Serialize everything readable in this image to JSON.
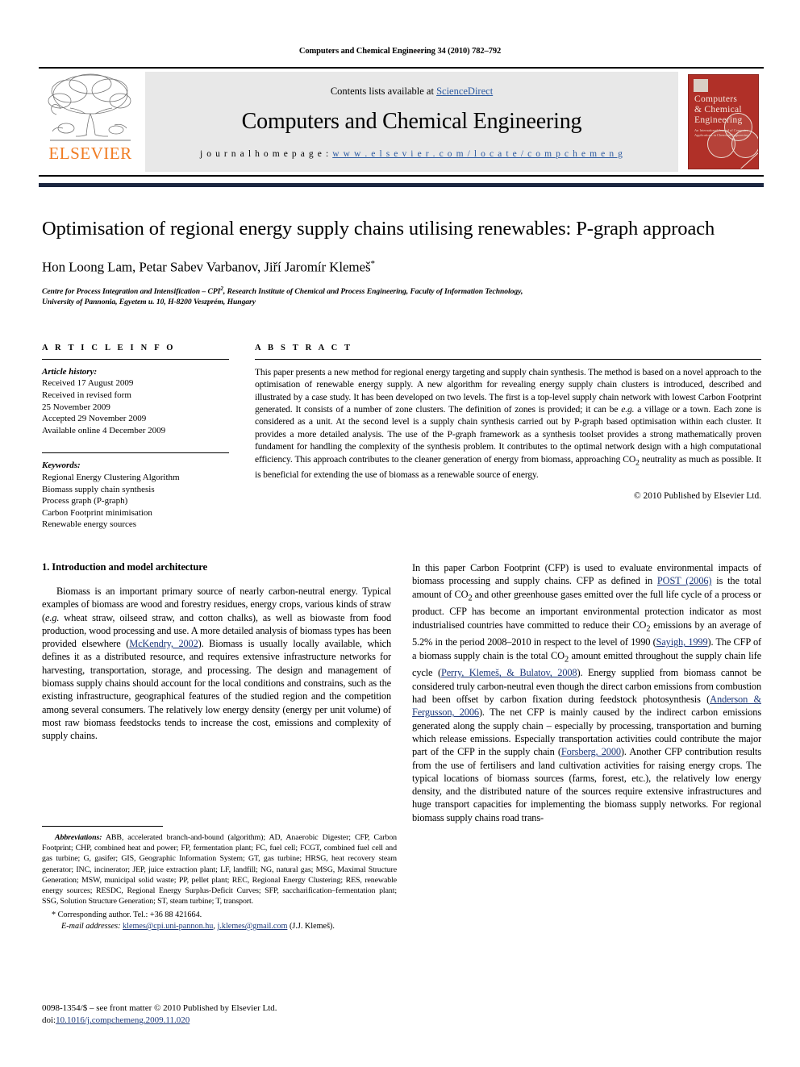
{
  "running_head": "Computers and Chemical Engineering 34 (2010) 782–792",
  "masthead": {
    "publisher_name": "ELSEVIER",
    "contents_prefix": "Contents lists available at ",
    "contents_link": "ScienceDirect",
    "journal_title": "Computers and Chemical Engineering",
    "homepage_label": "j o u r n a l   h o m e p a g e :  ",
    "homepage_url": "w w w . e l s e v i e r . c o m / l o c a t e / c o m p c h e m e n g",
    "cover": {
      "line1": "Computers",
      "line2": "& Chemical",
      "line3": "Engineering",
      "subtitle": "An International Journal of Computer Applications in Chemical Engineering"
    }
  },
  "article": {
    "title": "Optimisation of regional energy supply chains utilising renewables: P-graph approach",
    "authors": "Hon Loong Lam, Petar Sabev Varbanov, Jiří Jaromír Klemeš",
    "corresponding_marker": "*",
    "affiliation_line1": "Centre for Process Integration and Intensification – CPI2, Research Institute of Chemical and Process Engineering, Faculty of Information Technology,",
    "affiliation_line2": "University of Pannonia, Egyetem u. 10, H-8200 Veszprém, Hungary"
  },
  "article_info": {
    "heading": "A R T I C L E   I N F O",
    "history_label": "Article history:",
    "history": [
      "Received 17 August 2009",
      "Received in revised form",
      "25 November 2009",
      "Accepted 29 November 2009",
      "Available online 4 December 2009"
    ],
    "keywords_label": "Keywords:",
    "keywords": [
      "Regional Energy Clustering Algorithm",
      "Biomass supply chain synthesis",
      "Process graph (P-graph)",
      "Carbon Footprint minimisation",
      "Renewable energy sources"
    ]
  },
  "abstract": {
    "heading": "A B S T R A C T",
    "text_part1": "This paper presents a new method for regional energy targeting and supply chain synthesis. The method is based on a novel approach to the optimisation of renewable energy supply. A new algorithm for revealing energy supply chain clusters is introduced, described and illustrated by a case study. It has been developed on two levels. The first is a top-level supply chain network with lowest Carbon Footprint generated. It consists of a number of zone clusters. The definition of zones is provided; it can be ",
    "text_eg": "e.g.",
    "text_part2": " a village or a town. Each zone is considered as a unit. At the second level is a supply chain synthesis carried out by P-graph based optimisation within each cluster. It provides a more detailed analysis. The use of the P-graph framework as a synthesis toolset provides a strong mathematically proven fundament for handling the complexity of the synthesis problem. It contributes to the optimal network design with a high computational efficiency. This approach contributes to the cleaner generation of energy from biomass, approaching CO2 neutrality as much as possible. It is beneficial for extending the use of biomass as a renewable source of energy.",
    "copyright": "© 2010 Published by Elsevier Ltd."
  },
  "section1": {
    "number_title": "1. Introduction and model architecture",
    "para1_a": "Biomass is an important primary source of nearly carbon-neutral energy. Typical examples of biomass are wood and forestry residues, energy crops, various kinds of straw (",
    "para1_eg": "e.g.",
    "para1_b": " wheat straw, oilseed straw, and cotton chalks), as well as biowaste from food production, wood processing and use. A more detailed analysis of biomass types has been provided elsewhere (",
    "para1_ref1": "McKendry, 2002",
    "para1_c": "). Biomass is usually locally available, which defines it as a distributed resource, and requires extensive infrastructure networks for harvesting, transportation, storage, and processing. The design and management of biomass supply chains should account for the local conditions and constrains, such as the existing infrastructure, geographical features of the studied region and the competition among several consumers. The relatively low energy density (energy per unit volume) of most raw biomass feedstocks tends to increase the cost, emissions and complexity of supply chains.",
    "para2_a": "In this paper Carbon Footprint (CFP) is used to evaluate environmental impacts of biomass processing and supply chains. CFP as defined in ",
    "para2_ref1": "POST (2006)",
    "para2_b": " is the total amount of CO2 and other greenhouse gases emitted over the full life cycle of a process or product. CFP has become an important environmental protection indicator as most industrialised countries have committed to reduce their CO2 emissions by an average of 5.2% in the period 2008–2010 in respect to the level of 1990 (",
    "para2_ref2": "Sayigh, 1999",
    "para2_c": "). The CFP of a biomass supply chain is the total CO2 amount emitted throughout the supply chain life cycle (",
    "para2_ref3": "Perry, Klemeš, & Bulatov, 2008",
    "para2_d": "). Energy supplied from biomass cannot be considered truly carbon-neutral even though the direct carbon emissions from combustion had been offset by carbon fixation during feedstock photosynthesis (",
    "para2_ref4": "Anderson & Fergusson, 2006",
    "para2_e": "). The net CFP is mainly caused by the indirect carbon emissions generated along the supply chain – especially by processing, transportation and burning which release emissions. Especially transportation activities could contribute the major part of the CFP in the supply chain (",
    "para2_ref5": "Forsberg, 2000",
    "para2_f": "). Another CFP contribution results from the use of fertilisers and land cultivation activities for raising energy crops. The typical locations of biomass sources (farms, forest, etc.), the relatively low energy density, and the distributed nature of the sources require extensive infrastructures and huge transport capacities for implementing the biomass supply networks. For regional biomass supply chains road trans-"
  },
  "footnotes": {
    "abbrev_label": "Abbreviations:",
    "abbrev_text": " ABB, accelerated branch-and-bound (algorithm); AD, Anaerobic Digester; CFP, Carbon Footprint; CHP, combined heat and power; FP, fermentation plant; FC, fuel cell; FCGT, combined fuel cell and gas turbine; G, gasifer; GIS, Geographic Information System; GT, gas turbine; HRSG, heat recovery steam generator; INC, incinerator; JEP, juice extraction plant; LF, landfill; NG, natural gas; MSG, Maximal Structure Generation; MSW, municipal solid waste; PP, pellet plant; REC, Regional Energy Clustering; RES, renewable energy sources; RESDC, Regional Energy Surplus-Deficit Curves; SFP, saccharification–fermentation plant; SSG, Solution Structure Generation; ST, steam turbine; T, transport.",
    "corresponding": "* Corresponding author. Tel.: +36 88 421664.",
    "email_label": "E-mail addresses:",
    "email1": "klemes@cpi.uni-pannon.hu",
    "email_sep": ", ",
    "email2": "j.klemes@gmail.com",
    "email_suffix": " (J.J. Klemeš).",
    "imprint_line1": "0098-1354/$ – see front matter © 2010 Published by Elsevier Ltd.",
    "imprint_doi_label": "doi:",
    "imprint_doi": "10.1016/j.compchemeng.2009.11.020"
  }
}
